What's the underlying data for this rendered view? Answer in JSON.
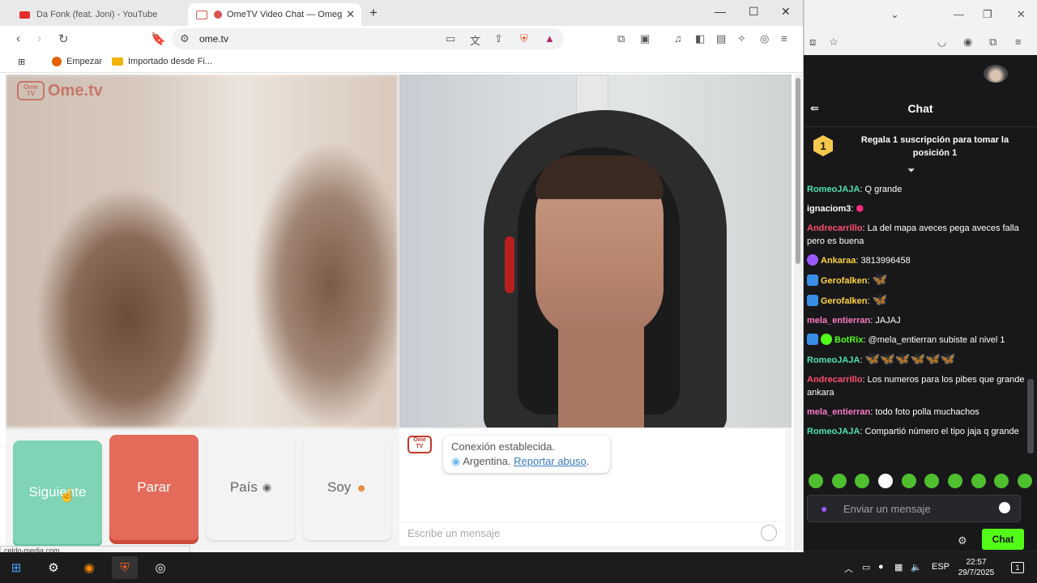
{
  "browser": {
    "tabs": [
      {
        "title": "Da Fonk (feat. Joni) - YouTube",
        "color": "#e52d27"
      },
      {
        "title": "OmeTV Video Chat — Omeg",
        "color": "#d9534f"
      }
    ],
    "new_tab": "+",
    "window_controls": {
      "minimize": "—",
      "maximize": "☐",
      "close": "✕"
    },
    "url": "ome.tv",
    "bookmarks": [
      {
        "label": "Empezar",
        "icon": "firefox-icon"
      },
      {
        "label": "Importado desde Fi...",
        "icon": "folder-icon"
      }
    ],
    "status_url": "celdo-media.com"
  },
  "ometv": {
    "logo_small": "Ome TV",
    "logo_word": "Ome.tv",
    "buttons": {
      "next": "Siguiente",
      "stop": "Parar",
      "country": "País",
      "gender": "Soy"
    },
    "system_message": {
      "status": "Conexión establecida.",
      "country": "Argentina.",
      "report": "Reportar abuso",
      "report_suffix": "."
    },
    "message_placeholder": "Escribe un mensaje"
  },
  "chat": {
    "title": "Chat",
    "pinned": {
      "rank": "1",
      "text": "Regala 1 suscripción para tomar la posición 1"
    },
    "messages": [
      {
        "user": "RomeoJAJA",
        "color": "#4fe0b0",
        "text": "Q grande"
      },
      {
        "user": "ignaciom3",
        "color": "#ffffff",
        "text": ""
      },
      {
        "user": "Andrecarrillo",
        "color": "#ff4f6f",
        "text": "La del mapa aveces pega aveces falla pero es buena"
      },
      {
        "user": "Ankaraa",
        "color": "#ffd23f",
        "text": "3813996458"
      },
      {
        "user": "Gerofalken",
        "color": "#ffd23f",
        "text": "🦋"
      },
      {
        "user": "Gerofalken",
        "color": "#ffd23f",
        "text": "🦋"
      },
      {
        "user": "mela_entierran",
        "color": "#ff79c6",
        "text": "JAJAJ"
      },
      {
        "user": "BotRix",
        "color": "#53fc18",
        "text": "@mela_entierran subiste al nivel 1"
      },
      {
        "user": "RomeoJAJA",
        "color": "#4fe0b0",
        "text": "🦋🦋🦋🦋🦋🦋"
      },
      {
        "user": "Andrecarrillo",
        "color": "#ff4f6f",
        "text": "Los numeros para los pibes que grande ankara"
      },
      {
        "user": "mela_entierran",
        "color": "#ff79c6",
        "text": "todo foto polla muchachos"
      },
      {
        "user": "RomeoJAJA",
        "color": "#4fe0b0",
        "text": "Compartió número el tipo jaja q grande"
      }
    ],
    "input_placeholder": "Enviar un mensaje",
    "send_button": "Chat",
    "accent_color": "#53fc18"
  },
  "taskbar": {
    "language": "ESP",
    "time": "22:57",
    "date": "29/7/2025",
    "notifications": "1"
  }
}
